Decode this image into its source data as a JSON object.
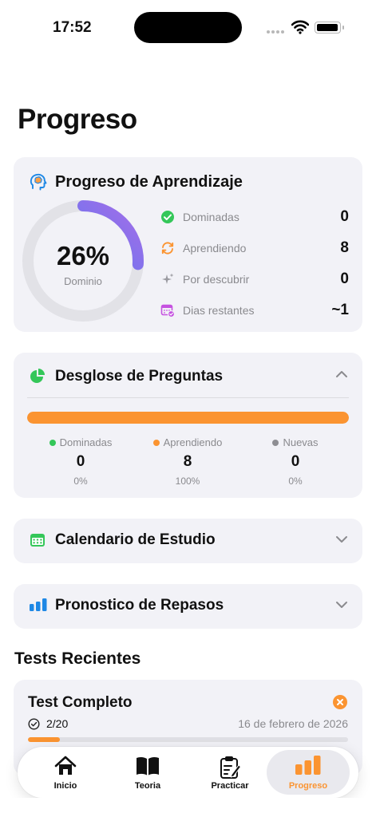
{
  "status_bar": {
    "time": "17:52"
  },
  "page": {
    "title": "Progreso"
  },
  "learning": {
    "title": "Progreso de Aprendizaje",
    "percent_text": "26%",
    "percent_value": 26,
    "percent_label": "Dominio",
    "stats": [
      {
        "label": "Dominadas",
        "value": "0",
        "icon": "checkmark-circle-icon",
        "color": "#34c759"
      },
      {
        "label": "Aprendiendo",
        "value": "8",
        "icon": "refresh-arrows-icon",
        "color": "#fb9431"
      },
      {
        "label": "Por descubrir",
        "value": "0",
        "icon": "sparkles-icon",
        "color": "#9a9aa0"
      },
      {
        "label": "Dias restantes",
        "value": "~1",
        "icon": "calendar-badge-icon",
        "color": "#c552e0"
      }
    ]
  },
  "breakdown": {
    "title": "Desglose de Preguntas",
    "learning_fraction": 1.0,
    "columns": [
      {
        "label": "Dominadas",
        "count": "0",
        "percent": "0%",
        "color": "#34c759"
      },
      {
        "label": "Aprendiendo",
        "count": "8",
        "percent": "100%",
        "color": "#fb9431"
      },
      {
        "label": "Nuevas",
        "count": "0",
        "percent": "0%",
        "color": "#8e8e93"
      }
    ]
  },
  "calendar": {
    "title": "Calendario de Estudio"
  },
  "forecast": {
    "title": "Pronostico de Repasos"
  },
  "recent": {
    "title": "Tests Recientes",
    "tests": [
      {
        "name": "Test Completo",
        "score": "2/20",
        "date": "16 de febrero de 2026",
        "progress_fraction": 0.1
      }
    ]
  },
  "tabs": [
    {
      "label": "Inicio",
      "icon": "house-icon"
    },
    {
      "label": "Teoria",
      "icon": "book-icon"
    },
    {
      "label": "Practicar",
      "icon": "clipboard-icon"
    },
    {
      "label": "Progreso",
      "icon": "bar-chart-icon",
      "active": true
    }
  ],
  "colors": {
    "accent": "#fb9431",
    "card": "#f2f2f7",
    "success": "#34c759"
  }
}
